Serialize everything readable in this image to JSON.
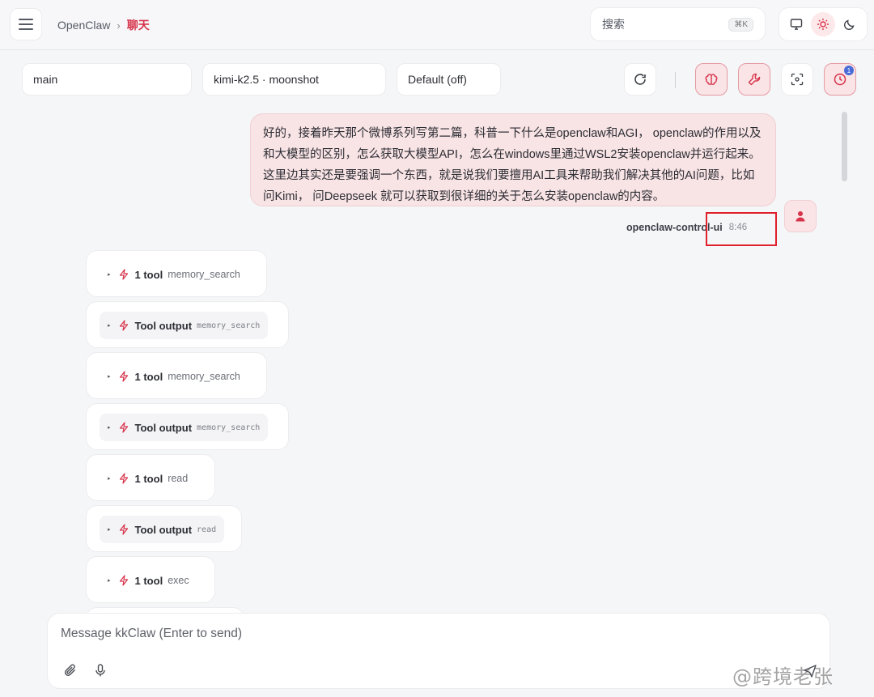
{
  "header": {
    "breadcrumb_home": "OpenClaw",
    "breadcrumb_sep": "›",
    "breadcrumb_current": "聊天",
    "search_label": "搜索",
    "search_shortcut": "⌘K",
    "theme_icons": [
      "monitor-icon",
      "sun-icon",
      "moon-icon"
    ],
    "active_theme": "sun"
  },
  "controls": {
    "session": "main",
    "model": "kimi-k2.5 · moonshot",
    "thinking": "Default (off)",
    "history_badge": "1",
    "icons": [
      "refresh-icon",
      "brain-icon",
      "wrench-icon",
      "focus-icon",
      "clock-icon"
    ]
  },
  "user_message": {
    "text": "好的，接着昨天那个微博系列写第二篇，科普一下什么是openclaw和AGI， openclaw的作用以及和大模型的区别，怎么获取大模型API，怎么在windows里通过WSL2安装openclaw并运行起来。 这里边其实还是要强调一个东西，就是说我们要擅用AI工具来帮助我们解决其他的AI问题，比如问Kimi， 问Deepseek 就可以获取到很详细的关于怎么安装openclaw的内容。",
    "sender": "openclaw-control-ui",
    "time": "8:46"
  },
  "tool_events": [
    {
      "kind": "call",
      "caret": "▸",
      "title": "1 tool",
      "name": "memory_search"
    },
    {
      "kind": "output",
      "caret": "▸",
      "title": "Tool output",
      "name": "memory_search"
    },
    {
      "kind": "call",
      "caret": "▸",
      "title": "1 tool",
      "name": "memory_search"
    },
    {
      "kind": "output",
      "caret": "▸",
      "title": "Tool output",
      "name": "memory_search"
    },
    {
      "kind": "call",
      "caret": "▸",
      "title": "1 tool",
      "name": "read"
    },
    {
      "kind": "output",
      "caret": "▸",
      "title": "Tool output",
      "name": "read"
    },
    {
      "kind": "call",
      "caret": "▸",
      "title": "1 tool",
      "name": "exec"
    }
  ],
  "composer": {
    "placeholder": "Message kkClaw (Enter to send)",
    "icons": [
      "paperclip-icon",
      "microphone-icon",
      "send-icon"
    ]
  },
  "watermark": "@跨境老张",
  "colors": {
    "accent": "#d6324a",
    "user_bubble": "#f8e3e5",
    "highlight_box": "#e0202b",
    "badge": "#4a6bd8"
  }
}
